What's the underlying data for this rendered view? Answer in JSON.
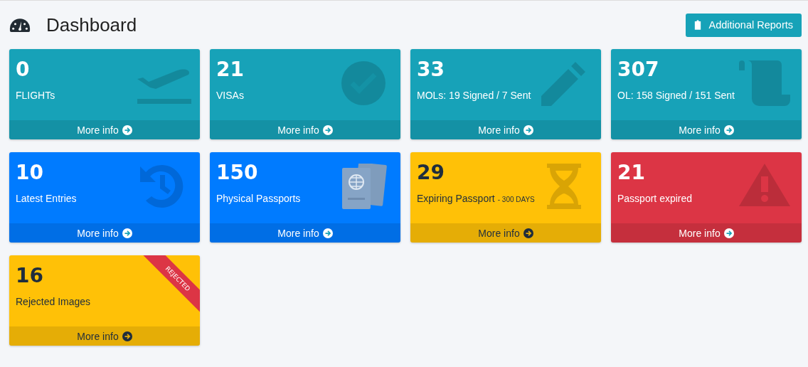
{
  "header": {
    "title": "Dashboard",
    "button": "Additional Reports"
  },
  "cards": [
    {
      "value": "0",
      "label": "FLIGHTs",
      "kind": "plane",
      "color": "#17a2b8",
      "footer": "More info"
    },
    {
      "value": "21",
      "label": "VISAs",
      "kind": "check",
      "color": "#17a2b8",
      "footer": "More info"
    },
    {
      "value": "33",
      "label": "MOLs: 19 Signed / 7 Sent",
      "kind": "pencil",
      "color": "#17a2b8",
      "footer": "More info"
    },
    {
      "value": "307",
      "label": "OL: 158 Signed / 151 Sent",
      "kind": "scroll",
      "color": "#17a2b8",
      "footer": "More info"
    },
    {
      "value": "10",
      "label": "Latest Entries",
      "kind": "history",
      "color": "#007bff",
      "footer": "More info"
    },
    {
      "value": "150",
      "label": "Physical Passports",
      "kind": "passport",
      "color": "#007bff",
      "footer": "More info"
    },
    {
      "value": "29",
      "label": "Expiring Passport",
      "note": "- 300 DAYS",
      "kind": "hourglass",
      "color": "#ffc107",
      "footer": "More info"
    },
    {
      "value": "21",
      "label": "Passport expired",
      "kind": "warning",
      "color": "#dc3545",
      "footer": "More info"
    },
    {
      "value": "16",
      "label": "Rejected Images",
      "kind": "ribbon",
      "ribbon": "REJECTED",
      "color": "#ffc107",
      "footer": "More info"
    }
  ]
}
